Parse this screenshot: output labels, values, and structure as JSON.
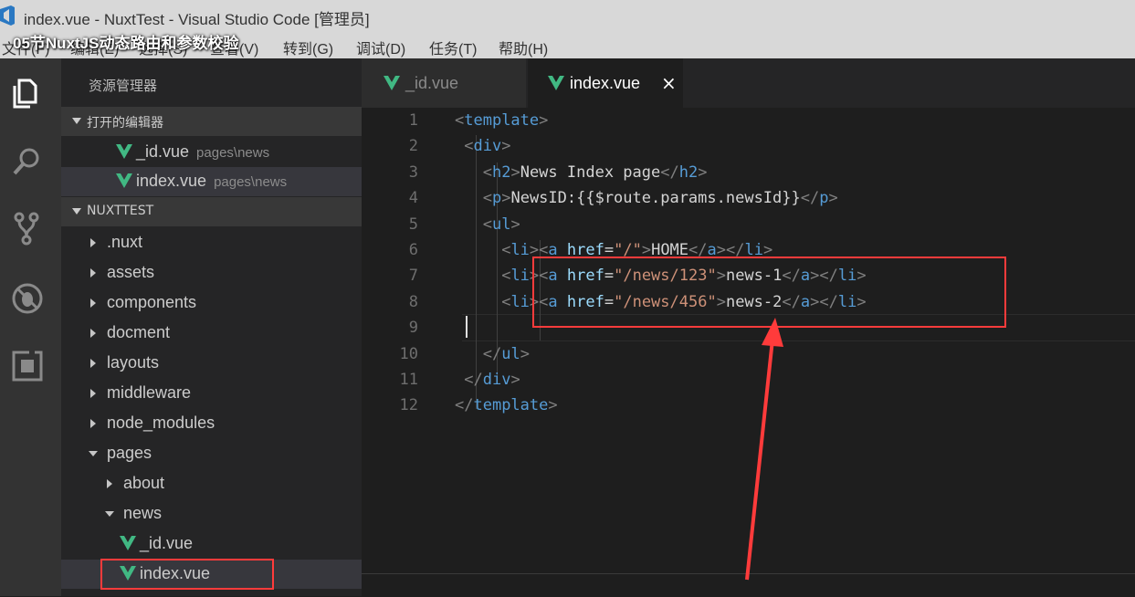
{
  "window": {
    "title": "index.vue - NuxtTest - Visual Studio Code [管理员]"
  },
  "overlay_caption": "05节NuxtJS动态路由和参数校验",
  "menu": {
    "items": [
      "文件(F)",
      "编辑(E)",
      "选择(S)",
      "查看(V)",
      "转到(G)",
      "调试(D)",
      "任务(T)",
      "帮助(H)"
    ]
  },
  "activity_bar": {
    "icons": [
      "files-icon",
      "search-icon",
      "source-control-icon",
      "debug-icon",
      "extensions-icon"
    ]
  },
  "sidebar": {
    "title": "资源管理器",
    "open_editors_label": "打开的编辑器",
    "open_editors": [
      {
        "name": "_id.vue",
        "path": "pages\\news"
      },
      {
        "name": "index.vue",
        "path": "pages\\news"
      }
    ],
    "project_label": "NUXTTEST",
    "tree": [
      {
        "name": ".nuxt"
      },
      {
        "name": "assets"
      },
      {
        "name": "components"
      },
      {
        "name": "docment"
      },
      {
        "name": "layouts"
      },
      {
        "name": "middleware"
      },
      {
        "name": "node_modules"
      },
      {
        "name": "pages"
      },
      {
        "name": "about"
      },
      {
        "name": "news"
      },
      {
        "name": "_id.vue"
      },
      {
        "name": "index.vue"
      }
    ]
  },
  "tabs": [
    {
      "label": "_id.vue",
      "active": false
    },
    {
      "label": "index.vue",
      "active": true
    }
  ],
  "tab_close": "×",
  "editor": {
    "line_numbers": [
      "1",
      "2",
      "3",
      "4",
      "5",
      "6",
      "7",
      "8",
      "9",
      "10",
      "11",
      "12"
    ],
    "lines": [
      [
        "<",
        "template",
        ">"
      ],
      [
        "<",
        "div",
        ">"
      ],
      [
        "<",
        "h2",
        ">",
        "News Index page",
        "</",
        "h2",
        ">"
      ],
      [
        "<",
        "p",
        ">",
        "NewsID:{{$route.params.newsId}}",
        "</",
        "p",
        ">"
      ],
      [
        "<",
        "ul",
        ">"
      ],
      [
        "<",
        "li",
        ">",
        "<",
        "a",
        " href",
        "=",
        "\"/\"",
        ">",
        "HOME",
        "</",
        "a",
        ">",
        "</",
        "li",
        ">"
      ],
      [
        "<",
        "li",
        ">",
        "<",
        "a",
        " href",
        "=",
        "\"/news/123\"",
        ">",
        "news-1",
        "</",
        "a",
        ">",
        "</",
        "li",
        ">"
      ],
      [
        "<",
        "li",
        ">",
        "<",
        "a",
        " href",
        "=",
        "\"/news/456\"",
        ">",
        "news-2",
        "</",
        "a",
        ">",
        "</",
        "li",
        ">"
      ],
      [],
      [
        "</",
        "ul",
        ">"
      ],
      [
        "</",
        "div",
        ">"
      ],
      [
        "</",
        "template",
        ">"
      ]
    ]
  },
  "colors": {
    "vue_green": "#41b883",
    "annotation_red": "#ff3b3b"
  }
}
